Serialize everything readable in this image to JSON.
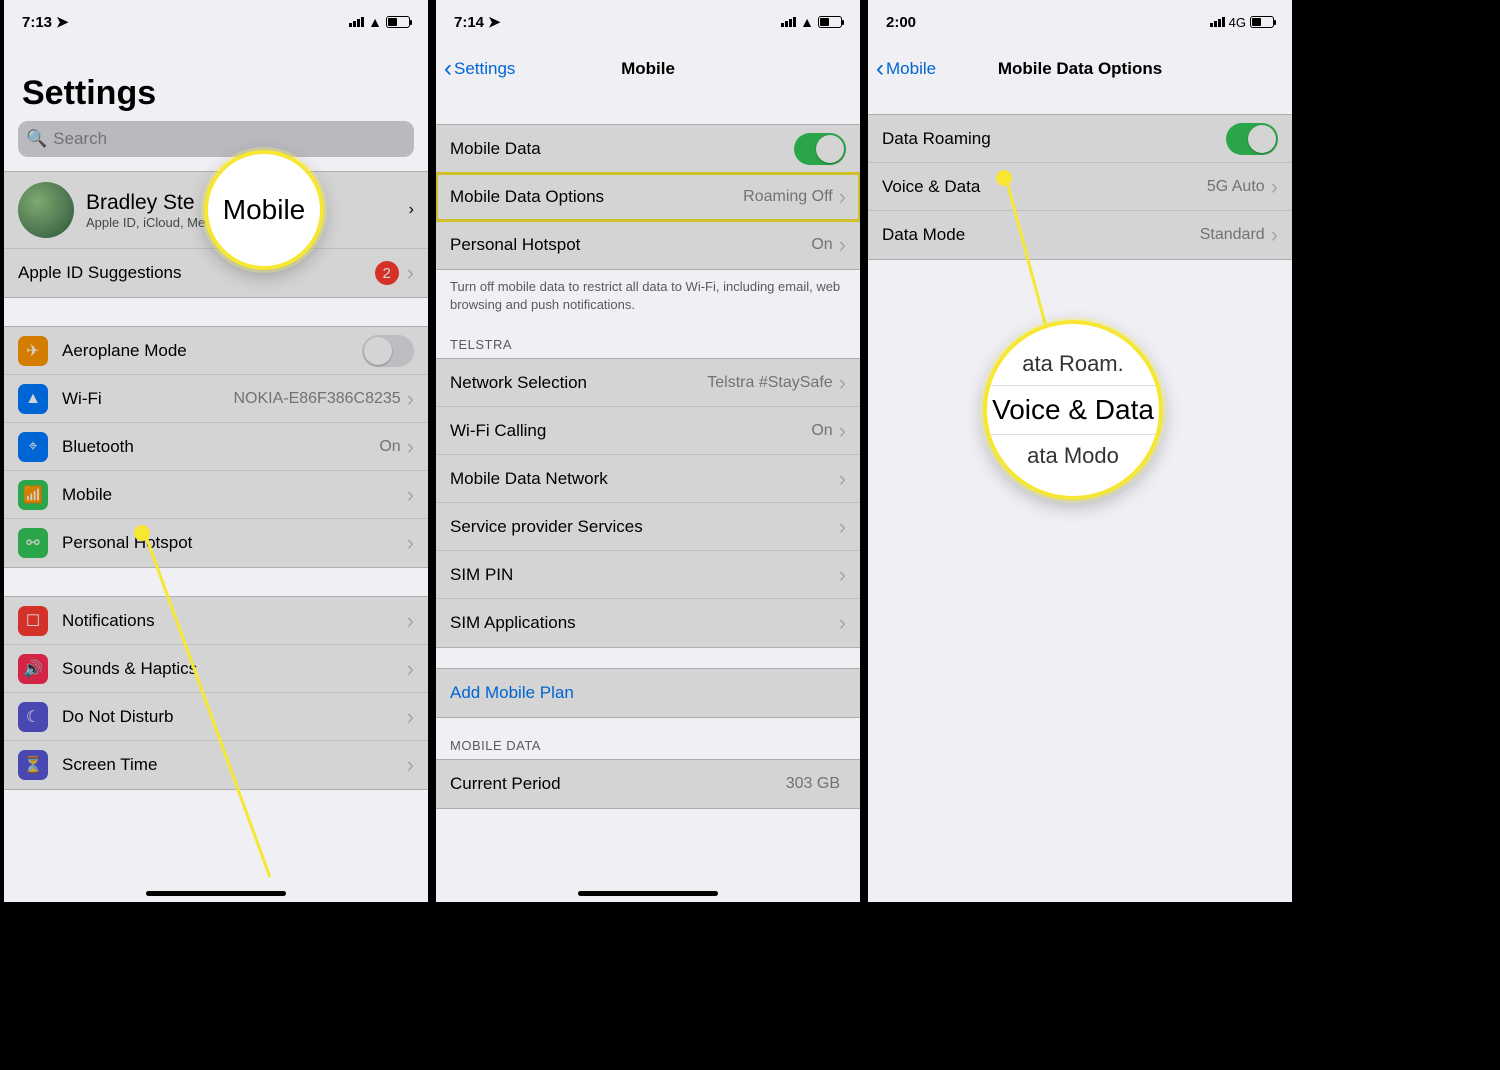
{
  "panel1": {
    "time": "7:13",
    "title": "Settings",
    "search_placeholder": "Search",
    "profile": {
      "name": "Bradley Ste",
      "sub": "Apple ID, iCloud, Med..  urchases"
    },
    "apple_id_suggestions": {
      "label": "Apple ID Suggestions",
      "badge": "2"
    },
    "rows": {
      "aeroplane": "Aeroplane Mode",
      "wifi": "Wi-Fi",
      "wifi_value": "NOKIA-E86F386C8235",
      "bluetooth": "Bluetooth",
      "bluetooth_value": "On",
      "mobile": "Mobile",
      "hotspot": "Personal Hotspot",
      "notifications": "Notifications",
      "sounds": "Sounds & Haptics",
      "dnd": "Do Not Disturb",
      "screentime": "Screen Time"
    },
    "zoom_text": "Mobile"
  },
  "panel2": {
    "time": "7:14",
    "back": "Settings",
    "title": "Mobile",
    "rows": {
      "mobile_data": "Mobile Data",
      "mobile_data_options": "Mobile Data Options",
      "mobile_data_options_value": "Roaming Off",
      "personal_hotspot": "Personal Hotspot",
      "personal_hotspot_value": "On"
    },
    "footer1": "Turn off mobile data to restrict all data to Wi-Fi, including email, web browsing and push notifications.",
    "carrier_header": "TELSTRA",
    "carrier_rows": {
      "network_selection": "Network Selection",
      "network_selection_value": "Telstra #StaySafe",
      "wifi_calling": "Wi-Fi Calling",
      "wifi_calling_value": "On",
      "mobile_data_network": "Mobile Data Network",
      "service_provider": "Service provider Services",
      "sim_pin": "SIM PIN",
      "sim_apps": "SIM Applications"
    },
    "add_plan": "Add Mobile Plan",
    "data_header": "MOBILE DATA",
    "current_period": "Current Period",
    "current_period_value": "303 GB"
  },
  "panel3": {
    "time": "2:00",
    "net": "4G",
    "back": "Mobile",
    "title": "Mobile Data Options",
    "rows": {
      "data_roaming": "Data Roaming",
      "voice_data": "Voice & Data",
      "voice_data_value": "5G Auto",
      "data_mode": "Data Mode",
      "data_mode_value": "Standard"
    },
    "zoom_top": "ata Roam.",
    "zoom_main": "Voice & Data",
    "zoom_bottom": "ata Modo"
  }
}
